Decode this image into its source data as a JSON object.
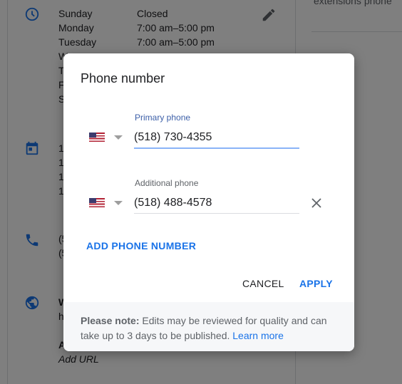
{
  "background": {
    "hours": [
      {
        "day": "Sunday",
        "time": "Closed"
      },
      {
        "day": "Monday",
        "time": "7:00 am–5:00 pm"
      },
      {
        "day": "Tuesday",
        "time": "7:00 am–5:00 pm"
      },
      {
        "day": "W",
        "time": ""
      },
      {
        "day": "T",
        "time": ""
      },
      {
        "day": "F",
        "time": ""
      },
      {
        "day": "S",
        "time": ""
      }
    ],
    "special_hours": [
      "1",
      "1",
      "1",
      "1"
    ],
    "phones": [
      "(5",
      "(5"
    ],
    "website_label": "W",
    "website_value": "h",
    "appointments_label": "A",
    "add_url": "Add URL",
    "right_panel_text": "extensions phone"
  },
  "dialog": {
    "title": "Phone number",
    "primary": {
      "label": "Primary phone",
      "value": "(518) 730-4355",
      "country": "US"
    },
    "additional": {
      "label": "Additional phone",
      "value": "(518) 488-4578",
      "country": "US"
    },
    "add_phone": "ADD PHONE NUMBER",
    "cancel": "CANCEL",
    "apply": "APPLY",
    "note_bold": "Please note:",
    "note_text": " Edits may be reviewed for quality and can take up to 3 days to be published. ",
    "learn_more": "Learn more",
    "accent": "#1a73e8"
  }
}
